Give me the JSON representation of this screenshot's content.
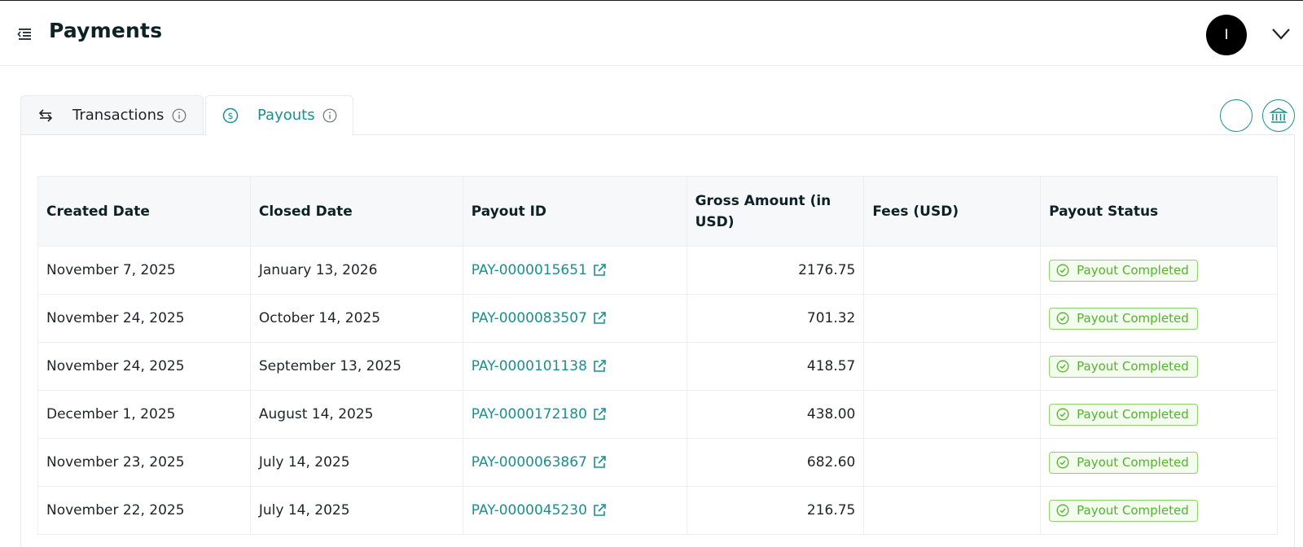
{
  "header": {
    "title": "Payments",
    "avatar_initial": "I"
  },
  "tabs": [
    {
      "label": "Transactions",
      "active": false
    },
    {
      "label": "Payouts",
      "active": true
    }
  ],
  "colors": {
    "accent": "#1a8f8f",
    "status_green": "#52b52a"
  },
  "table": {
    "columns": [
      "Created Date",
      "Closed Date",
      "Payout ID",
      "Gross Amount (in USD)",
      "Fees (USD)",
      "Payout Status"
    ],
    "rows": [
      {
        "created": "November 7, 2025",
        "closed": "January 13, 2026",
        "payout_id": "PAY-0000015651",
        "gross": "2176.75",
        "fees": "",
        "status": "Payout Completed"
      },
      {
        "created": "November 24, 2025",
        "closed": "October 14, 2025",
        "payout_id": "PAY-0000083507",
        "gross": "701.32",
        "fees": "",
        "status": "Payout Completed"
      },
      {
        "created": "November 24, 2025",
        "closed": "September 13, 2025",
        "payout_id": "PAY-0000101138",
        "gross": "418.57",
        "fees": "",
        "status": "Payout Completed"
      },
      {
        "created": "December 1, 2025",
        "closed": "August 14, 2025",
        "payout_id": "PAY-0000172180",
        "gross": "438.00",
        "fees": "",
        "status": "Payout Completed"
      },
      {
        "created": "November 23, 2025",
        "closed": "July 14, 2025",
        "payout_id": "PAY-0000063867",
        "gross": "682.60",
        "fees": "",
        "status": "Payout Completed"
      },
      {
        "created": "November 22, 2025",
        "closed": "July 14, 2025",
        "payout_id": "PAY-0000045230",
        "gross": "216.75",
        "fees": "",
        "status": "Payout Completed"
      }
    ]
  },
  "icons": {
    "menu": "menu-collapse-icon",
    "chevron": "chevron-down-icon",
    "transactions": "swap-arrows-icon",
    "payouts": "dollar-circle-icon",
    "info": "info-icon",
    "bank": "bank-icon",
    "external": "external-link-icon",
    "check": "check-circle-icon"
  }
}
